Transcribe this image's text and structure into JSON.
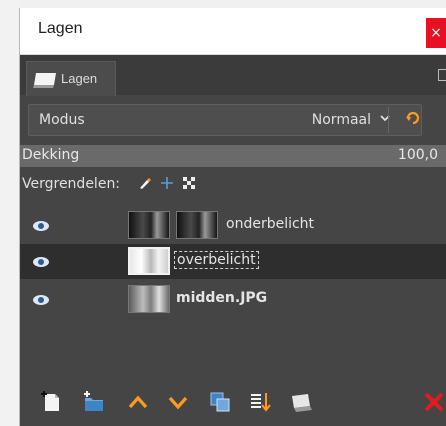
{
  "window": {
    "title": "Lagen",
    "close_glyph": "×"
  },
  "tab": {
    "label": "Lagen",
    "icon": "layers-tab-icon"
  },
  "mode": {
    "label": "Modus",
    "value": "Normaal",
    "dropdown_icon": "chevron-down-icon",
    "composite_icon": "composite-mode-icon"
  },
  "opacity": {
    "label": "Dekking",
    "value": "100,0"
  },
  "lock": {
    "label": "Vergrendelen:",
    "icons": [
      "lock-pixels-icon",
      "lock-position-icon",
      "lock-alpha-icon"
    ]
  },
  "layers": [
    {
      "name": "onderbelicht",
      "visible": true,
      "selected": false,
      "has_mask": true,
      "bold": false
    },
    {
      "name": "overbelicht",
      "visible": true,
      "selected": true,
      "has_mask": false,
      "bold": false
    },
    {
      "name": "midden.JPG",
      "visible": true,
      "selected": false,
      "has_mask": false,
      "bold": true
    }
  ],
  "toolbar": {
    "icons": [
      "new-layer-icon",
      "new-layer-group-icon",
      "raise-layer-icon",
      "lower-layer-icon",
      "duplicate-layer-icon",
      "merge-down-icon",
      "anchor-layer-icon",
      "delete-layer-icon"
    ]
  },
  "colors": {
    "panel": "#454545",
    "accent_orange": "#ff9a1a",
    "selection": "#2e2e2e",
    "delete_red": "#e31b1b",
    "blue": "#5b9bd5",
    "close_red": "#e81123"
  }
}
